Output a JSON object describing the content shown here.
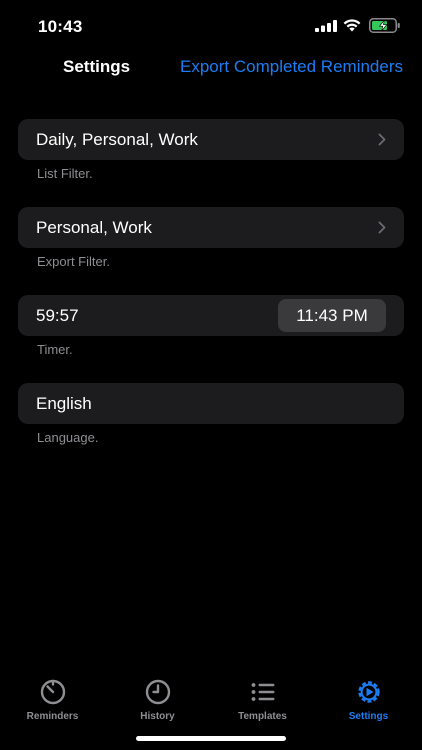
{
  "status_bar": {
    "time": "10:43"
  },
  "nav": {
    "title": "Settings",
    "export_label": "Export Completed Reminders"
  },
  "rows": {
    "list_filter": {
      "value": "Daily, Personal, Work",
      "footnote": "List Filter."
    },
    "export_filter": {
      "value": "Personal, Work",
      "footnote": "Export Filter."
    },
    "timer": {
      "value": "59:57",
      "time": "11:43 PM",
      "footnote": "Timer."
    },
    "language": {
      "value": "English",
      "footnote": "Language."
    }
  },
  "tab_bar": {
    "tabs": [
      {
        "label": "Reminders",
        "icon": "timer-icon"
      },
      {
        "label": "History",
        "icon": "clock-icon"
      },
      {
        "label": "Templates",
        "icon": "list-icon"
      },
      {
        "label": "Settings",
        "icon": "gear-play-icon"
      }
    ],
    "active_index": 3
  },
  "colors": {
    "accent": "#1d7cf2",
    "cell_background": "#1c1c1e",
    "secondary_text": "#8e8e93",
    "battery_fill": "#34c759"
  }
}
